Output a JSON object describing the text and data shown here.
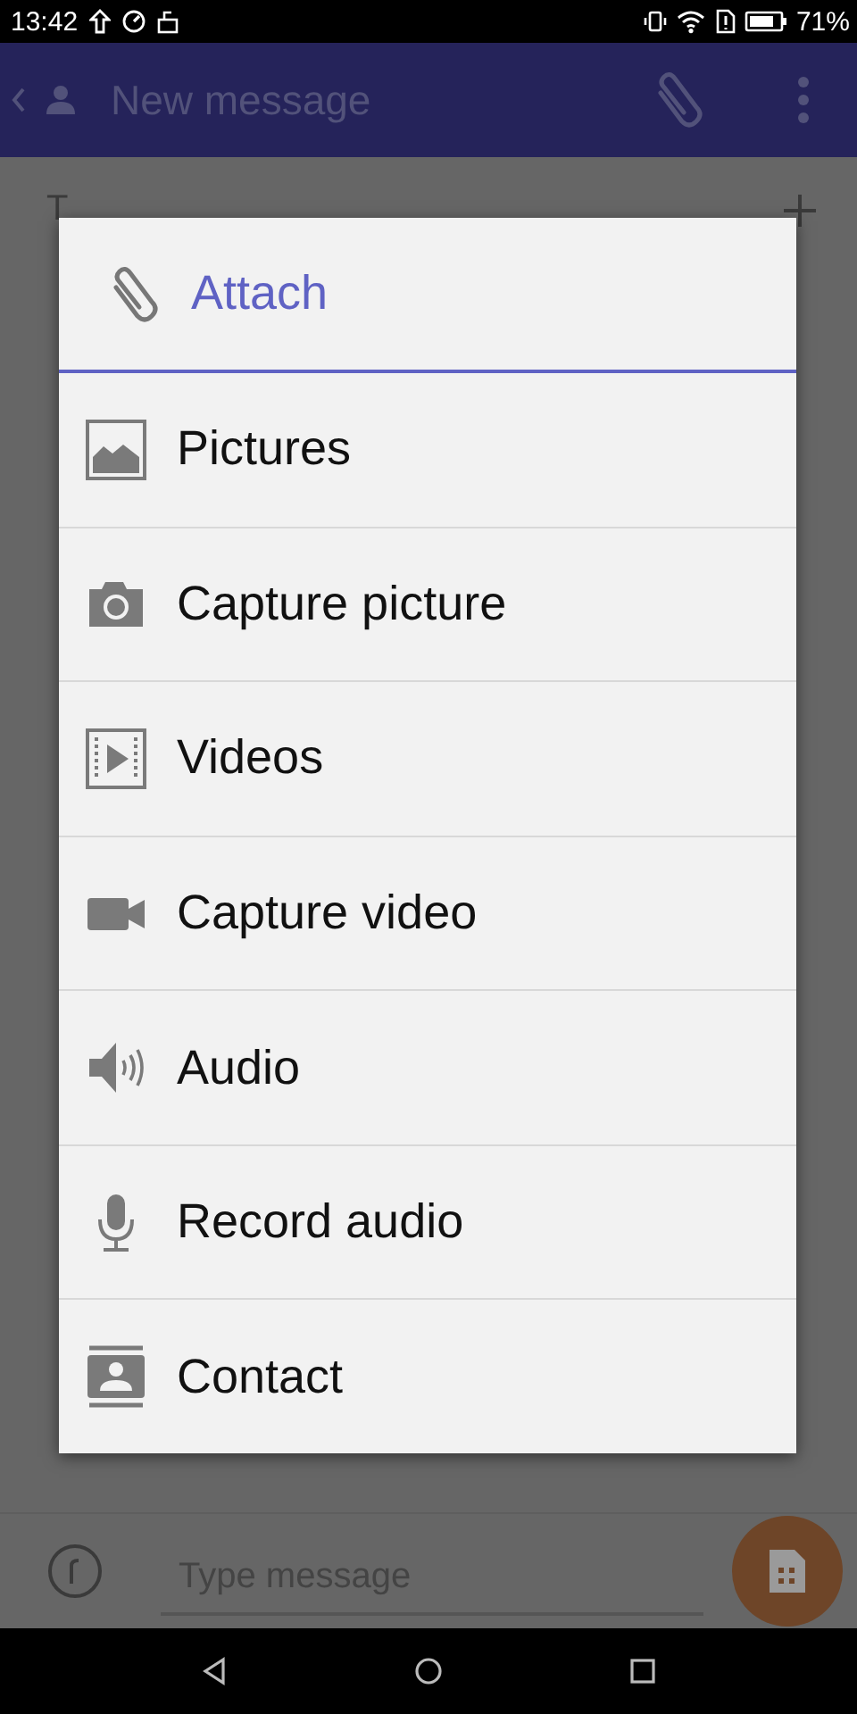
{
  "status_bar": {
    "time": "13:42",
    "battery": "71%"
  },
  "app_bar": {
    "title": "New message"
  },
  "recipient": {
    "label": "T"
  },
  "compose": {
    "placeholder": "Type message"
  },
  "dialog": {
    "title": "Attach",
    "items": [
      {
        "kind": "pictures",
        "label": "Pictures"
      },
      {
        "kind": "camera",
        "label": "Capture picture"
      },
      {
        "kind": "videos",
        "label": "Videos"
      },
      {
        "kind": "videocam",
        "label": "Capture video"
      },
      {
        "kind": "audio",
        "label": "Audio"
      },
      {
        "kind": "mic",
        "label": "Record audio"
      },
      {
        "kind": "contact",
        "label": "Contact"
      }
    ]
  }
}
